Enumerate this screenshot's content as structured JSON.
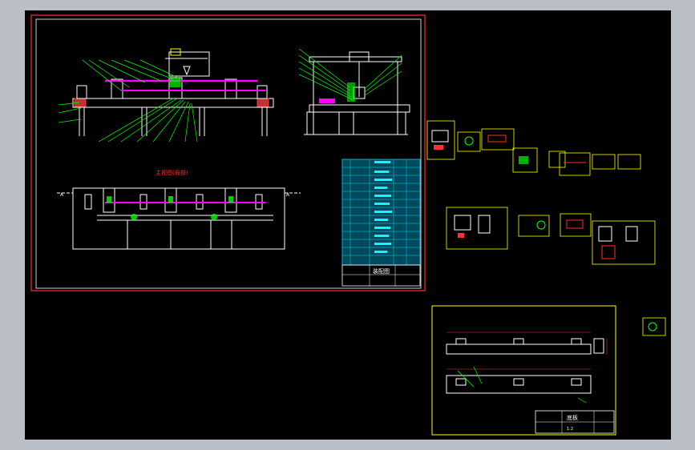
{
  "drawing": {
    "main_sheet": {
      "section_label": "A-A",
      "section_caption": "主视图(局部)",
      "side_marks": [
        "A",
        "A"
      ],
      "title_block_text": "装配图"
    },
    "part_sheet": {
      "title_block_text": "底板",
      "scale_text": "1:2"
    },
    "colors": {
      "background": "#000000",
      "frame_outer": "#ff3030",
      "geometry": "#ffffff",
      "leader": "#00ff00",
      "highlight": "#ff00ff",
      "table_fill": "#00d0ff",
      "title_frame": "#ffff00"
    }
  }
}
